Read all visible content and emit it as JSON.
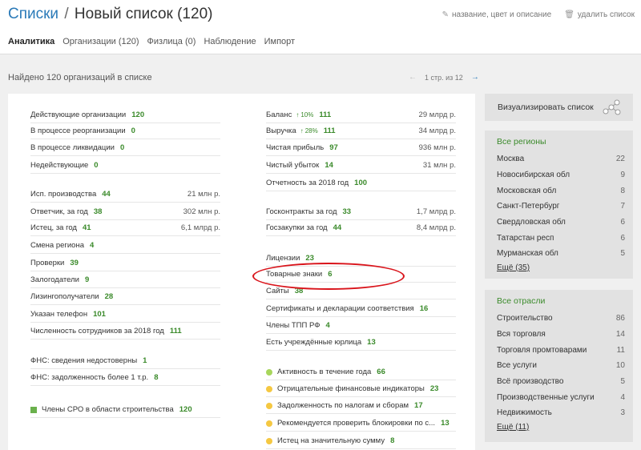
{
  "header": {
    "breadcrumb_root": "Списки",
    "separator": "/",
    "list_title": "Новый список (120)",
    "edit_action": "название, цвет и описание",
    "delete_action": "удалить список"
  },
  "tabs": [
    "Аналитика",
    "Организации (120)",
    "Физлица (0)",
    "Наблюдение",
    "Импорт"
  ],
  "found_text": "Найдено 120 организаций в списке",
  "pager": {
    "text": "1 стр. из 12"
  },
  "left_col": [
    {
      "label": "Действующие организации",
      "count": "120"
    },
    {
      "label": "В процессе реорганизации",
      "count": "0"
    },
    {
      "label": "В процессе ликвидации",
      "count": "0"
    },
    {
      "label": "Недействующие",
      "count": "0"
    },
    {
      "label": "Исп. производства",
      "count": "44",
      "value": "21 млн р."
    },
    {
      "label": "Ответчик, за год",
      "count": "38",
      "value": "302 млн р."
    },
    {
      "label": "Истец, за год",
      "count": "41",
      "value": "6,1 млрд р."
    },
    {
      "label": "Смена региона",
      "count": "4"
    },
    {
      "label": "Проверки",
      "count": "39"
    },
    {
      "label": "Залогодатели",
      "count": "9"
    },
    {
      "label": "Лизингополучатели",
      "count": "28"
    },
    {
      "label": "Указан телефон",
      "count": "101"
    },
    {
      "label": "Численность сотрудников за 2018 год",
      "count": "111"
    },
    {
      "label": "ФНС: сведения недостоверны",
      "count": "1"
    },
    {
      "label": "ФНС: задолженность более 1 т.р.",
      "count": "8"
    },
    {
      "label": "Члены СРО в области строительства",
      "count": "120"
    }
  ],
  "right_col": [
    {
      "label": "Баланс",
      "pct": "10%",
      "count": "111",
      "value": "29 млрд р."
    },
    {
      "label": "Выручка",
      "pct": "28%",
      "count": "111",
      "value": "34 млрд р."
    },
    {
      "label": "Чистая прибыль",
      "count": "97",
      "value": "936 млн р."
    },
    {
      "label": "Чистый убыток",
      "count": "14",
      "value": "31 млн р."
    },
    {
      "label": "Отчетность за 2018 год",
      "count": "100"
    },
    {
      "label": "Госконтракты за год",
      "count": "33",
      "value": "1,7 млрд р."
    },
    {
      "label": "Госзакупки за год",
      "count": "44",
      "value": "8,4 млрд р."
    },
    {
      "label": "Лицензии",
      "count": "23"
    },
    {
      "label": "Товарные знаки",
      "count": "6"
    },
    {
      "label": "Сайты",
      "count": "38"
    },
    {
      "label": "Сертификаты и декларации соответствия",
      "count": "16"
    },
    {
      "label": "Члены ТПП РФ",
      "count": "4"
    },
    {
      "label": "Есть учреждённые юрлица",
      "count": "13"
    },
    {
      "label": "Активность в течение года",
      "count": "66"
    },
    {
      "label": "Отрицательные финансовые индикаторы",
      "count": "23"
    },
    {
      "label": "Задолженность по налогам и сборам",
      "count": "17"
    },
    {
      "label": "Рекомендуется проверить блокировки по с...",
      "count": "13"
    },
    {
      "label": "Истец на значительную сумму",
      "count": "8"
    }
  ],
  "colors": {
    "green_dot": "#a8d65c",
    "yellow_dot": "#f5c842",
    "square": "#6ab04c",
    "accent": "#3a8a2a",
    "link": "#2a7ab8",
    "highlight": "#d9141b"
  },
  "visualize": {
    "label": "Визуализировать список",
    "icon": "network-icon"
  },
  "regions": {
    "header": "Все регионы",
    "items": [
      {
        "name": "Москва",
        "n": "22"
      },
      {
        "name": "Новосибирская обл",
        "n": "9"
      },
      {
        "name": "Московская обл",
        "n": "8"
      },
      {
        "name": "Санкт-Петербург",
        "n": "7"
      },
      {
        "name": "Свердловская обл",
        "n": "6"
      },
      {
        "name": "Татарстан респ",
        "n": "6"
      },
      {
        "name": "Мурманская обл",
        "n": "5"
      }
    ],
    "more": "Ещё (35)"
  },
  "sectors": {
    "header": "Все отрасли",
    "items": [
      {
        "name": "Строительство",
        "n": "86"
      },
      {
        "name": "Вся торговля",
        "n": "14"
      },
      {
        "name": "Торговля промтоварами",
        "n": "11"
      },
      {
        "name": "Все услуги",
        "n": "10"
      },
      {
        "name": "Всё производство",
        "n": "5"
      },
      {
        "name": "Производственные услуги",
        "n": "4"
      },
      {
        "name": "Недвижимость",
        "n": "3"
      }
    ],
    "more": "Ещё (11)"
  }
}
